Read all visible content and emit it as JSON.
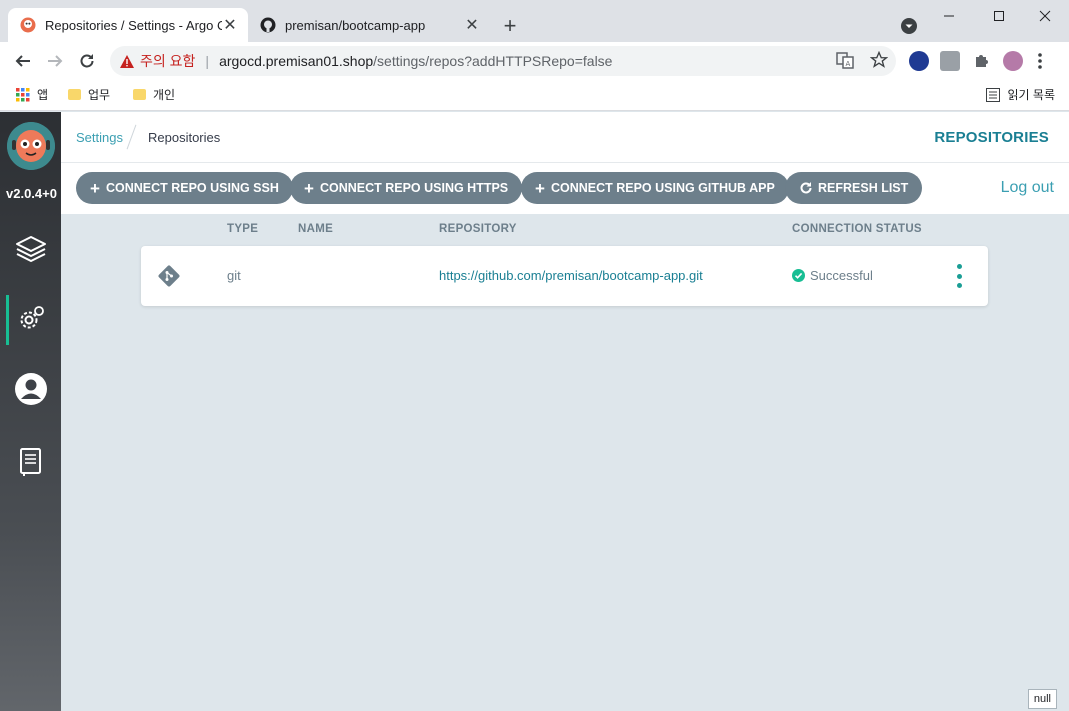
{
  "browser": {
    "tabs": [
      {
        "title": "Repositories / Settings - Argo CD",
        "active": true
      },
      {
        "title": "premisan/bootcamp-app",
        "active": false
      }
    ],
    "security_warning": "주의 요함",
    "url_host": "argocd.premisan01.shop",
    "url_rest": "/settings/repos?addHTTPSRepo=false",
    "bookmarks": [
      {
        "label": "앱",
        "icon": "apps-grid-icon"
      },
      {
        "label": "업무",
        "icon": "folder-icon"
      },
      {
        "label": "개인",
        "icon": "folder-icon"
      }
    ],
    "reading_list": "읽기 목록"
  },
  "sidebar": {
    "version": "v2.0.4+0",
    "items": [
      {
        "name": "applications",
        "icon": "layers-icon"
      },
      {
        "name": "settings",
        "icon": "gear-icon",
        "active": true
      },
      {
        "name": "user-info",
        "icon": "user-icon"
      },
      {
        "name": "documentation",
        "icon": "book-icon"
      }
    ]
  },
  "header": {
    "breadcrumb_parent": "Settings",
    "breadcrumb_current": "Repositories",
    "title": "REPOSITORIES"
  },
  "actions": {
    "connect_ssh": "CONNECT REPO USING SSH",
    "connect_https": "CONNECT REPO USING HTTPS",
    "connect_github_app": "CONNECT REPO USING GITHUB APP",
    "refresh": "REFRESH LIST",
    "logout": "Log out"
  },
  "table": {
    "columns": [
      "TYPE",
      "NAME",
      "REPOSITORY",
      "CONNECTION STATUS"
    ],
    "rows": [
      {
        "type": "git",
        "name": "",
        "repository": "https://github.com/premisan/bootcamp-app.git",
        "status": "Successful"
      }
    ]
  },
  "footer_badge": "null",
  "colors": {
    "accent": "#1a7f93",
    "button": "#6d7f8b",
    "success": "#18be94"
  }
}
